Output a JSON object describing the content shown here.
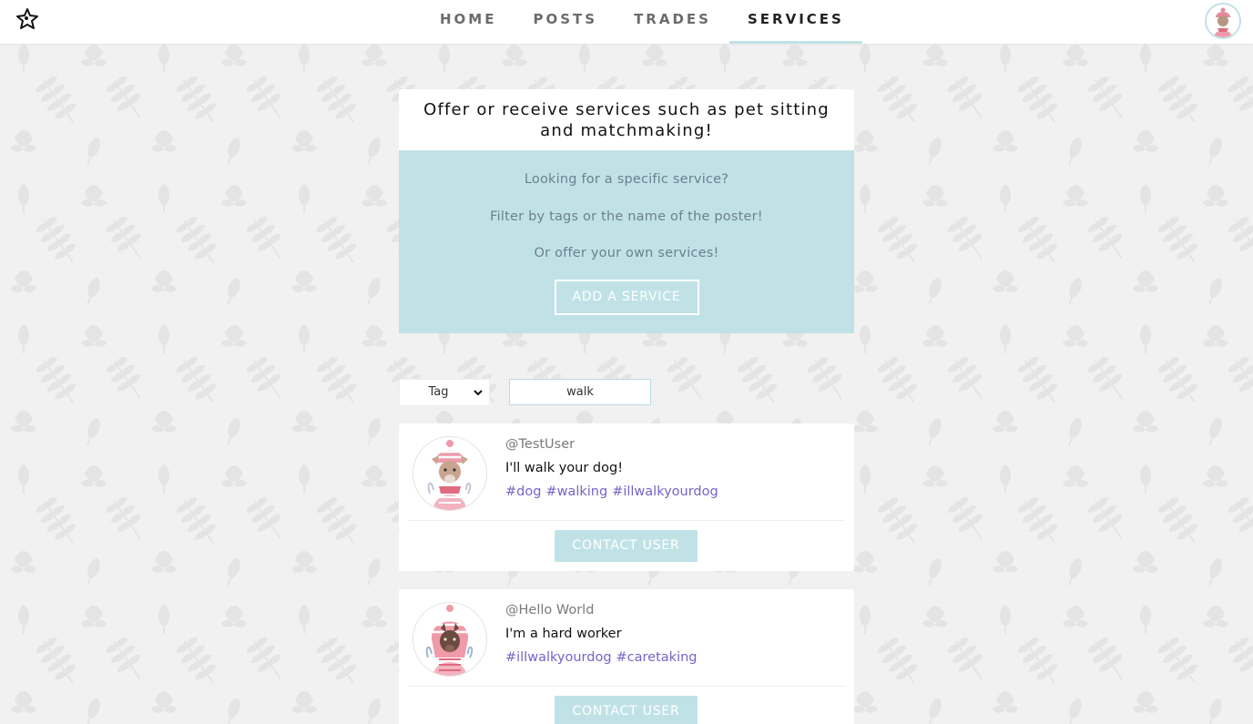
{
  "nav": {
    "links": [
      {
        "label": "HOME"
      },
      {
        "label": "POSTS"
      },
      {
        "label": "TRADES"
      },
      {
        "label": "SERVICES"
      }
    ],
    "active": "SERVICES"
  },
  "intro": {
    "title": "Offer or receive services such as pet sitting and matchmaking!",
    "banner_lines": [
      "Looking for a specific service?",
      "Filter by tags or the name of the poster!",
      "Or offer your own services!"
    ],
    "add_button": "ADD A SERVICE"
  },
  "filter": {
    "selected": "Tag",
    "search_value": "walk"
  },
  "services": [
    {
      "user": "@TestUser",
      "description": "I'll walk your dog!",
      "tags": [
        "#dog",
        "#walking",
        "#illwalkyourdog"
      ],
      "contact_label": "CONTACT USER"
    },
    {
      "user": "@Hello World",
      "description": "I'm a hard worker",
      "tags": [
        "#illwalkyourdog",
        "#caretaking"
      ],
      "contact_label": "CONTACT USER"
    }
  ],
  "icons": {
    "logo": "star-pet-logo-icon",
    "select_caret": "chevron-down-icon"
  },
  "colors": {
    "accent": "#c0e2e7",
    "tag": "#7366c7",
    "background": "#f1f1f1"
  }
}
